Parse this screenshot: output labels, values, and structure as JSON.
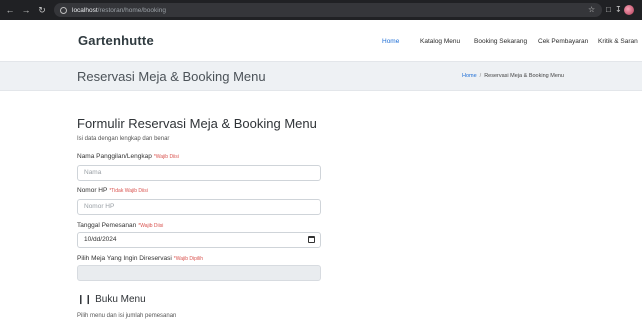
{
  "browser": {
    "url_host": "localhost",
    "url_path": "/restoran/home/booking"
  },
  "navbar": {
    "brand": "Gartenhutte",
    "items": [
      {
        "label": "Home",
        "active": true
      },
      {
        "label": "Katalog Menu",
        "active": false
      },
      {
        "label": "Booking Sekarang",
        "active": false
      },
      {
        "label": "Cek Pembayaran",
        "active": false
      },
      {
        "label": "Kritik & Saran",
        "active": false
      }
    ]
  },
  "hero": {
    "title": "Reservasi Meja & Booking Menu",
    "breadcrumb_home": "Home",
    "breadcrumb_sep": "/",
    "breadcrumb_current": "Reservasi Meja & Booking Menu"
  },
  "form": {
    "title": "Formulir Reservasi Meja & Booking Menu",
    "subtitle": "Isi data dengan lengkap dan benar",
    "name_label": "Nama Panggilan/Lengkap",
    "name_req": "*Wajib Diisi",
    "name_placeholder": "Nama",
    "phone_label": "Nomor HP",
    "phone_req": "*Tidak Wajib Diisi",
    "phone_placeholder": "Nomor HP",
    "date_label": "Tanggal Pemesanan",
    "date_req": "*Wajib Diisi",
    "date_value": "10/dd/2024",
    "table_label": "Pilih Meja Yang Ingin Direservasi",
    "table_req": "*Wajib Dipilih",
    "table_value": ""
  },
  "buku_menu": {
    "title": "Buku Menu",
    "subtitle": "Pilih menu dan isi jumlah pemesanan"
  }
}
